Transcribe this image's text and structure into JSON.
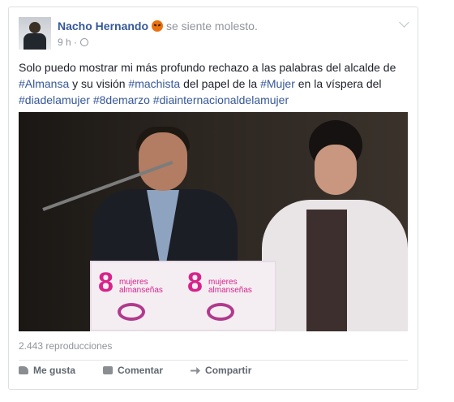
{
  "post": {
    "author": "Nacho Hernando",
    "feeling": "se siente molesto.",
    "time": "9 h ·",
    "text_plain_1": "Solo puedo mostrar mi más profundo rechazo a las palabras del alcalde de",
    "hashtag_1": "#Almansa",
    "text_plain_2": " y su visión ",
    "hashtag_2": "#machista",
    "text_plain_3": " del papel de la ",
    "hashtag_3": "#Mujer",
    "text_plain_4": " en la víspera del",
    "hashtag_4": "#diadelamujer",
    "hashtag_5": "#8demarzo",
    "hashtag_6": "#diainternacionaldelamujer",
    "views": "2.443 reproducciones"
  },
  "video": {
    "sign_number": "8",
    "sign_text": "mujeres almanseñas",
    "accent_color": "#d8238a"
  },
  "actions": {
    "like": "Me gusta",
    "comment": "Comentar",
    "share": "Compartir"
  },
  "icons": [
    "angry-face-icon",
    "globe-icon",
    "chevron-down-icon",
    "like-icon",
    "comment-icon",
    "share-icon"
  ],
  "colors": {
    "link": "#365899",
    "meta": "#90949c"
  }
}
